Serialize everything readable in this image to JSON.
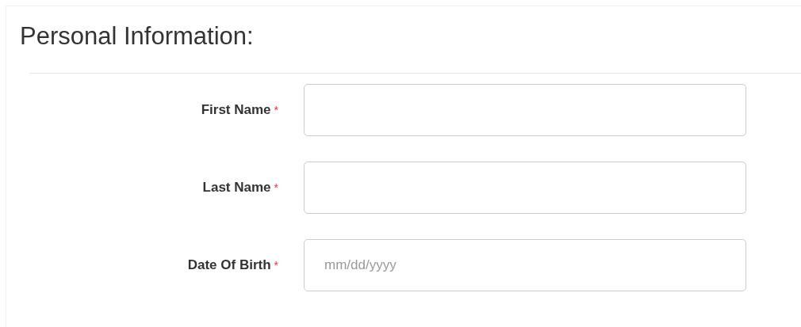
{
  "title": "Personal Information:",
  "fields": [
    {
      "label": "First Name",
      "required_mark": "*"
    },
    {
      "label": "Last Name",
      "required_mark": "*"
    },
    {
      "label": "Date Of Birth",
      "required_mark": "*",
      "placeholder": "mm/dd/yyyy"
    }
  ]
}
